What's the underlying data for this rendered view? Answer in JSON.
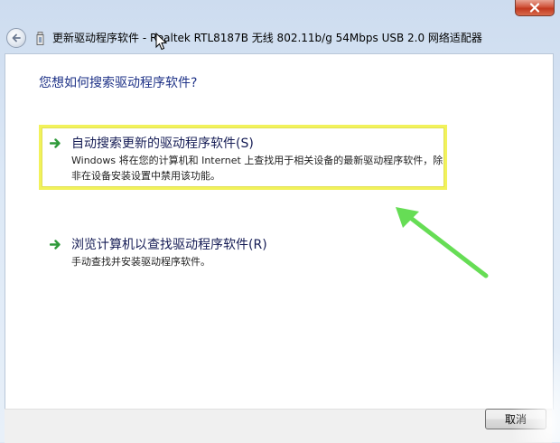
{
  "window": {
    "title": "更新驱动程序软件 - Realtek RTL8187B 无线 802.11b/g 54Mbps USB 2.0 网络适配器"
  },
  "main": {
    "question": "您想如何搜索驱动程序软件?",
    "options": [
      {
        "title": "自动搜索更新的驱动程序软件(S)",
        "description": "Windows 将在您的计算机和 Internet 上查找用于相关设备的最新驱动程序软件，除非在设备安装设置中禁用该功能。",
        "icon": "green-arrow-icon"
      },
      {
        "title": "浏览计算机以查找驱动程序软件(R)",
        "description": "手动查找并安装驱动程序软件。",
        "icon": "green-arrow-icon"
      }
    ]
  },
  "footer": {
    "cancel_label": "取消"
  },
  "colors": {
    "heading": "#1e3287",
    "highlight_border": "#f2f25a",
    "annotation_arrow": "#66dd55",
    "option_arrow": "#2f9a3a"
  }
}
